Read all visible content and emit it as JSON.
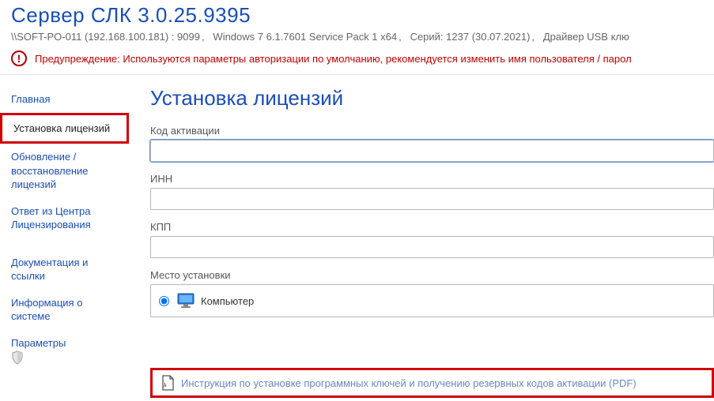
{
  "header": {
    "title": "Сервер СЛК 3.0.25.9395",
    "host": "\\\\SOFT-PO-011 (192.168.100.181) : 9099",
    "os": "Windows 7 6.1.7601 Service Pack 1 x64",
    "serial": "Серий: 1237 (30.07.2021)",
    "driver": "Драйвер USB клю"
  },
  "warning": {
    "text": "Предупреждение: Используются параметры авторизации по умолчанию, рекомендуется изменить имя пользователя / парол"
  },
  "sidebar": {
    "items": [
      {
        "label": "Главная"
      },
      {
        "label": "Установка лицензий"
      },
      {
        "label": "Обновление / восстановление лицензий"
      },
      {
        "label": "Ответ из Центра Лицензирования"
      },
      {
        "label": "Документация и ссылки"
      },
      {
        "label": "Информация о системе"
      },
      {
        "label": "Параметры"
      }
    ]
  },
  "main": {
    "title": "Установка лицензий",
    "fields": {
      "activation_code": {
        "label": "Код активации",
        "value": ""
      },
      "inn": {
        "label": "ИНН",
        "value": ""
      },
      "kpp": {
        "label": "КПП",
        "value": ""
      },
      "install_place": {
        "label": "Место установки",
        "option": "Компьютер"
      }
    },
    "pdf_link": "Инструкция по установке программных ключей и получению резервных кодов активации (PDF)"
  }
}
